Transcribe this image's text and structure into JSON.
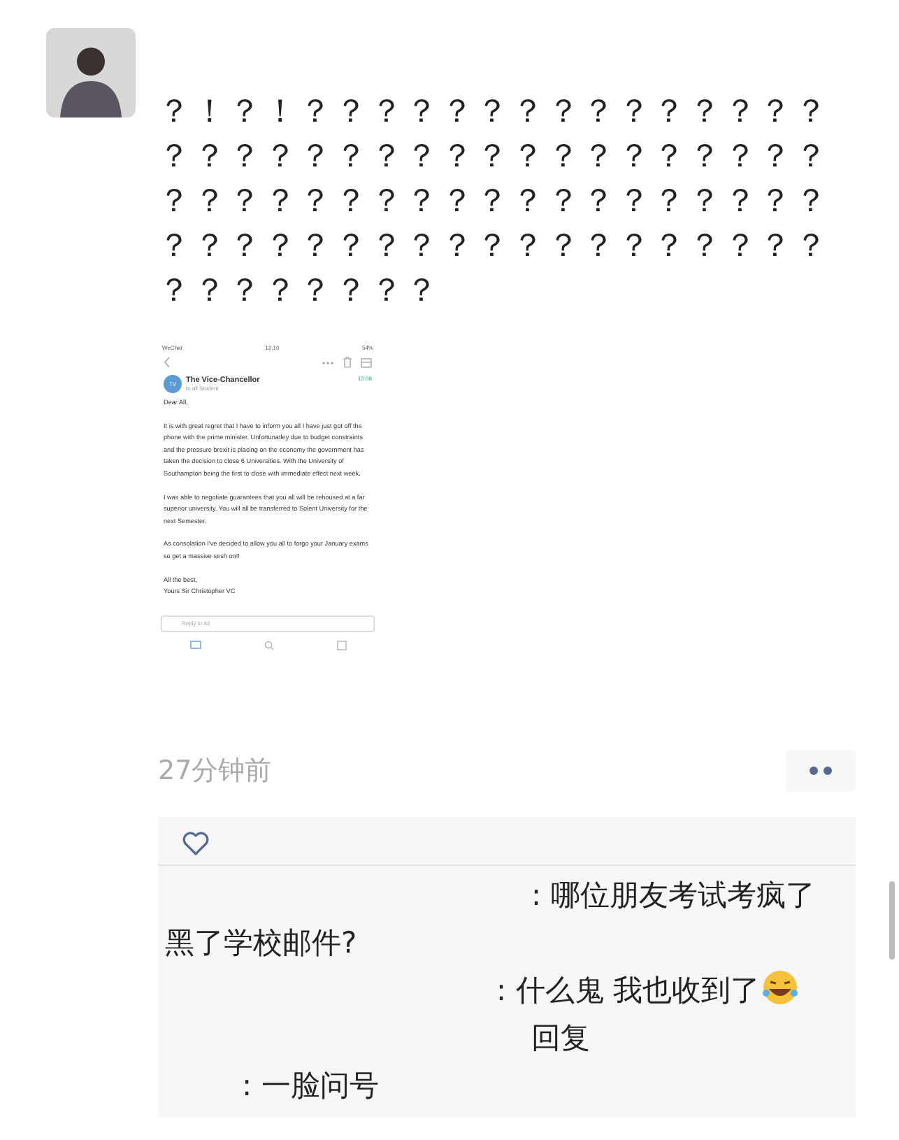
{
  "post": {
    "text": "？！？！？？？？？？？？？？？？？？？？？？？？？？？？？？？？？？？？？？？？？？？？？？？？？？？？？？？？？？？？？？？？？？？？？？？？？？？？？？？？？？？？",
    "time": "27分钟前"
  },
  "email": {
    "status_carrier": "WeChat",
    "status_time": "12:10",
    "status_battery": "54%",
    "sender_initials": "TV",
    "sender": "The Vice-Chancellor",
    "recipient": "to all Student",
    "time": "12:08",
    "paragraphs": [
      "Dear All,",
      "It is with great regret that I have to inform you all I have just got off the phone with the prime minister. Unfortunatley due to budget constraints and the pressure brexit is placing on the economy the government has taken the decision to close 6 Universities. With the University of Southampton being the first to close with immediate effect next week.",
      "I was able to negotiate guarantees that you all will be rehoused at a far superior university. You will all be transferred to Solent University for the next Semester.",
      "As consolation I've decided to allow you all to forgo your January exams so get a massive sesh on!!",
      "All the best,\nYours Sir Christopher VC"
    ],
    "reply_placeholder": "Reply to All"
  },
  "comments": [
    {
      "kind": "comment",
      "text": ": 哪位朋友考试考疯了黑了学校邮件?",
      "emoji": false
    },
    {
      "kind": "comment",
      "text": ": 什么鬼 我也收到了",
      "emoji": true
    },
    {
      "kind": "reply",
      "reply_word": "回复",
      "text": ": 一脸问号",
      "emoji": false
    }
  ]
}
